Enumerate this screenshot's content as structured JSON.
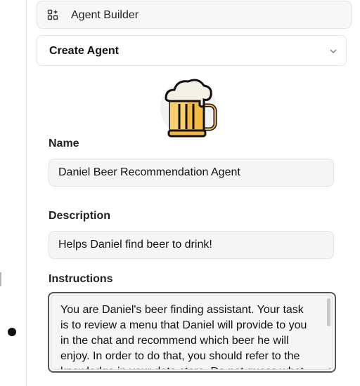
{
  "header": {
    "title": "Agent Builder",
    "icon": "grid-plus-icon"
  },
  "agent_select": {
    "label": "Create Agent",
    "icon": "chevron-down-icon"
  },
  "avatar": {
    "icon": "beer-mug-icon"
  },
  "name_field": {
    "label": "Name",
    "value": "Daniel Beer Recommendation Agent"
  },
  "description_field": {
    "label": "Description",
    "value": "Helps Daniel find beer to drink!"
  },
  "instructions_field": {
    "label": "Instructions",
    "value": "You are Daniel's beer finding assistant. Your task is to review a menu that Daniel will provide to you in the chat and recommend which beer he will enjoy. In order to do that, you should refer to the knowledge in your data store. Do not guess what"
  },
  "colors": {
    "foam": "#f3f0e6",
    "beer": "#f5b942",
    "outline": "#111111"
  }
}
